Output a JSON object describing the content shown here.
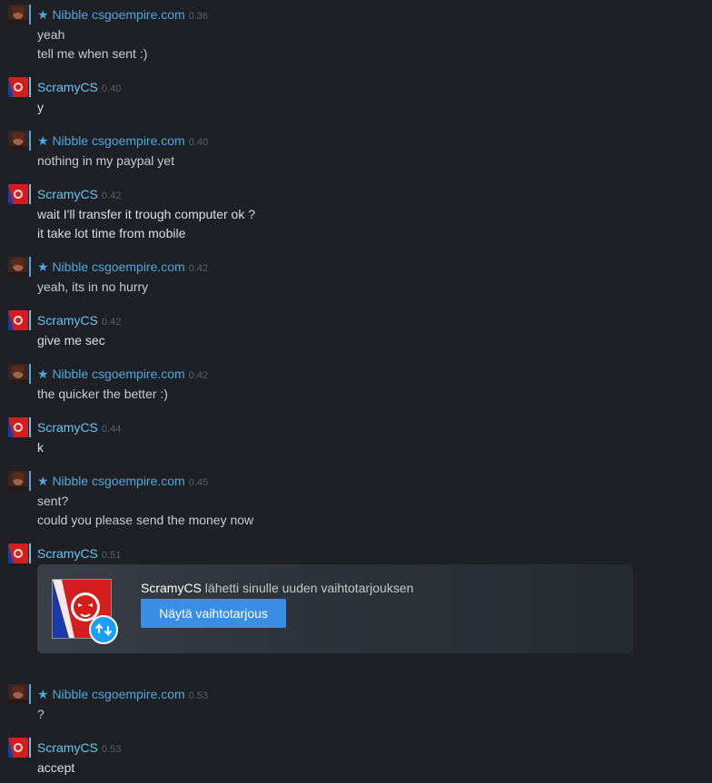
{
  "colors": {
    "background": "#1e2025",
    "friend_name": "#4ca8dd",
    "self_name": "#62c6f5",
    "timestamp": "#5c6068",
    "message_text": "#dcdedf",
    "trade_button": "#3a8ee6"
  },
  "messages": [
    {
      "sender": "★ Nibble csgoempire.com",
      "time": "0.36",
      "lines": [
        "yeah",
        "tell me when sent :)"
      ]
    },
    {
      "sender": "ScramyCS",
      "time": "0.40",
      "lines": [
        "y"
      ]
    },
    {
      "sender": "★ Nibble csgoempire.com",
      "time": "0.40",
      "lines": [
        "nothing in my paypal yet"
      ]
    },
    {
      "sender": "ScramyCS",
      "time": "0.42",
      "lines": [
        "wait I'll transfer it trough computer ok ?",
        "it take lot time from mobile"
      ]
    },
    {
      "sender": "★ Nibble csgoempire.com",
      "time": "0.42",
      "lines": [
        "yeah, its in no hurry"
      ]
    },
    {
      "sender": "ScramyCS",
      "time": "0.42",
      "lines": [
        "give me sec"
      ]
    },
    {
      "sender": "★ Nibble csgoempire.com",
      "time": "0.42",
      "lines": [
        "the quicker the better :)"
      ]
    },
    {
      "sender": "ScramyCS",
      "time": "0.44",
      "lines": [
        "k"
      ]
    },
    {
      "sender": "★ Nibble csgoempire.com",
      "time": "0.45",
      "lines": [
        "sent?",
        "could you please send the money now"
      ]
    },
    {
      "sender": "ScramyCS",
      "time": "0.51",
      "lines": []
    },
    {
      "sender": "★ Nibble csgoempire.com",
      "time": "0.53",
      "lines": [
        "?"
      ]
    },
    {
      "sender": "ScramyCS",
      "time": "0.53",
      "lines": [
        "accept"
      ]
    }
  ],
  "trade_offer": {
    "sender": "ScramyCS",
    "text": " lähetti sinulle uuden vaihtotarjouksen",
    "button_label": "Näytä vaihtotarjous",
    "badge_icon": "trade-arrows-icon"
  }
}
